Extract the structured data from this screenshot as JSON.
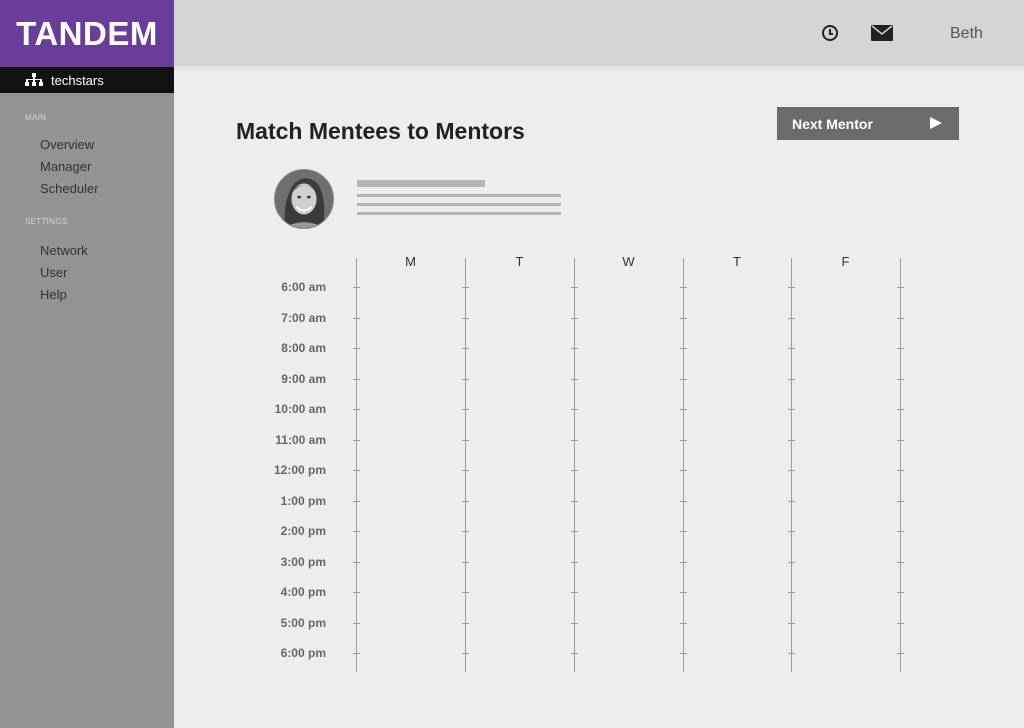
{
  "app": {
    "logo": "TANDEM",
    "org": "techstars"
  },
  "sidebar": {
    "sections": [
      {
        "label": "MAIN",
        "items": [
          "Overview",
          "Manager",
          "Scheduler"
        ]
      },
      {
        "label": "SETTINGS",
        "items": [
          "Network",
          "User",
          "Help"
        ]
      }
    ]
  },
  "topbar": {
    "user": "Beth",
    "icons": [
      "clock-icon",
      "mail-icon"
    ]
  },
  "main": {
    "title": "Match Mentees to Mentors",
    "next_button": "Next Mentor"
  },
  "calendar": {
    "days": [
      "M",
      "T",
      "W",
      "T",
      "F"
    ],
    "times": [
      "6:00 am",
      "7:00 am",
      "8:00 am",
      "9:00 am",
      "10:00 am",
      "11:00 am",
      "12:00 pm",
      "1:00 pm",
      "2:00 pm",
      "3:00 pm",
      "4:00 pm",
      "5:00 pm",
      "6:00 pm"
    ]
  },
  "colors": {
    "brand": "#6a3d9a",
    "sidebar": "#939393",
    "topbar": "#d4d4d4",
    "button": "#6b6b6b"
  }
}
